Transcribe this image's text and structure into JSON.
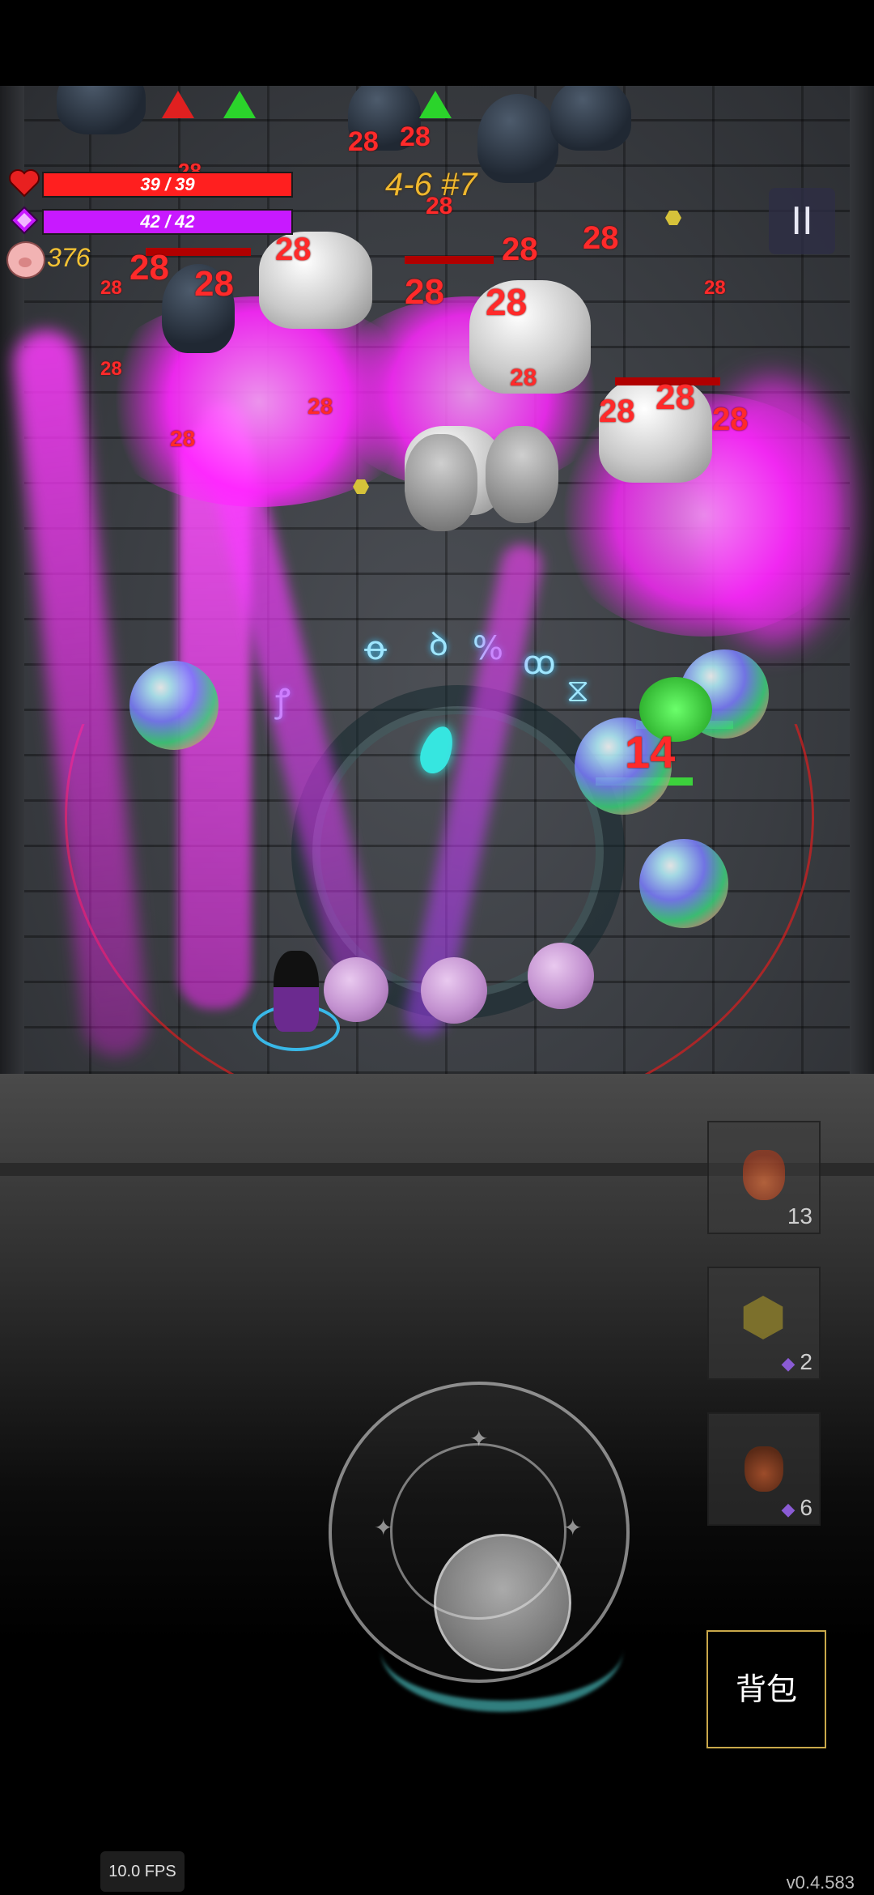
{
  "hud": {
    "hp_text": "39 / 39",
    "hp_fraction": 1.0,
    "mp_text": "42 / 42",
    "mp_fraction": 1.0,
    "coins": "376",
    "stage": "4-6 #7",
    "pause_label": "II"
  },
  "combat": {
    "enemy_damage_numbers": [
      "28",
      "28",
      "28",
      "28",
      "28",
      "28",
      "28",
      "28",
      "28",
      "28",
      "28",
      "28",
      "28",
      "28",
      "28",
      "28",
      "28",
      "28",
      "28",
      "28"
    ],
    "enemy_hit_number": "14"
  },
  "quick_slots": [
    {
      "icon": "red-potion-icon",
      "count": "13",
      "cost_gem": false
    },
    {
      "icon": "crystal-icosahedron-icon",
      "count": "2",
      "cost_gem": true
    },
    {
      "icon": "clay-pot-icon",
      "count": "6",
      "cost_gem": true
    }
  ],
  "bag_label": "背包",
  "fps_label": "10.0 FPS",
  "version_label": "v0.4.583",
  "colors": {
    "hp": "#ff1f1f",
    "mp": "#c819ff",
    "coin_text": "#f3c233",
    "stage_text": "#f0b82e",
    "magic": "#ff26ff",
    "bag_border": "#c9a84a"
  }
}
